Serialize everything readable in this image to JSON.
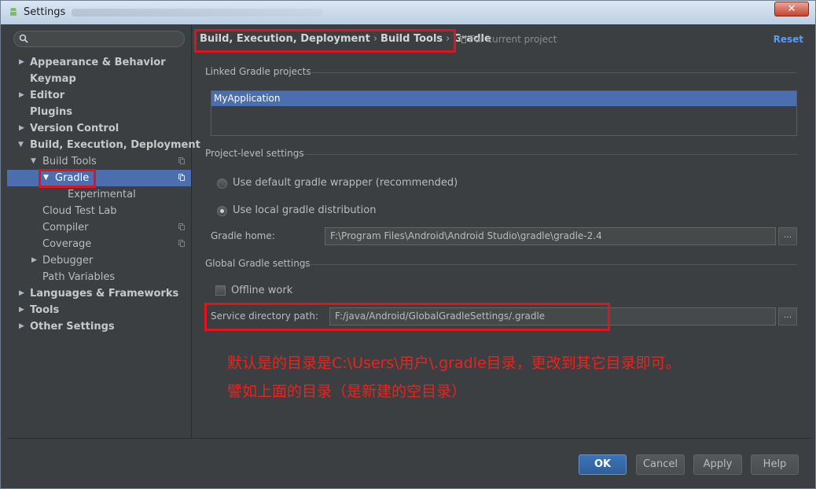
{
  "window": {
    "title": "Settings",
    "close_label": "✕"
  },
  "sidebar": {
    "items": [
      {
        "label": "Appearance & Behavior"
      },
      {
        "label": "Keymap"
      },
      {
        "label": "Editor"
      },
      {
        "label": "Plugins"
      },
      {
        "label": "Version Control"
      },
      {
        "label": "Build, Execution, Deployment"
      },
      {
        "label": "Build Tools"
      },
      {
        "label": "Gradle"
      },
      {
        "label": "Experimental"
      },
      {
        "label": "Cloud Test Lab"
      },
      {
        "label": "Compiler"
      },
      {
        "label": "Coverage"
      },
      {
        "label": "Debugger"
      },
      {
        "label": "Path Variables"
      },
      {
        "label": "Languages & Frameworks"
      },
      {
        "label": "Tools"
      },
      {
        "label": "Other Settings"
      }
    ],
    "selected": "Gradle"
  },
  "header": {
    "breadcrumb": [
      "Build, Execution, Deployment",
      "Build Tools",
      "Gradle"
    ],
    "breadcrumb_sep": "›",
    "scope": "For current project",
    "reset": "Reset"
  },
  "linked": {
    "title": "Linked Gradle projects",
    "projects": [
      "MyApplication"
    ]
  },
  "project_level": {
    "title": "Project-level settings",
    "option_wrapper": "Use default gradle wrapper (recommended)",
    "option_local": "Use local gradle distribution",
    "selected": "local",
    "gradle_home_label": "Gradle home:",
    "gradle_home_value": "F:\\Program Files\\Android\\Android Studio\\gradle\\gradle-2.4"
  },
  "global": {
    "title": "Global Gradle settings",
    "offline_label": "Offline work",
    "offline_checked": false,
    "service_label": "Service directory path:",
    "service_value": "F:/java/Android/GlobalGradleSettings/.gradle",
    "browse": "..."
  },
  "annotation": {
    "line1": "默认是的目录是C:\\Users\\用户\\.gradle目录，更改到其它目录即可。",
    "line2": "譬如上面的目录（是新建的空目录）",
    "color": "#e8241e"
  },
  "buttons": {
    "ok": "OK",
    "cancel": "Cancel",
    "apply": "Apply",
    "help": "Help"
  },
  "colors": {
    "background": "#3c3f41",
    "selection": "#4b6eaf",
    "link": "#589df6",
    "highlight": "#e0141e"
  }
}
